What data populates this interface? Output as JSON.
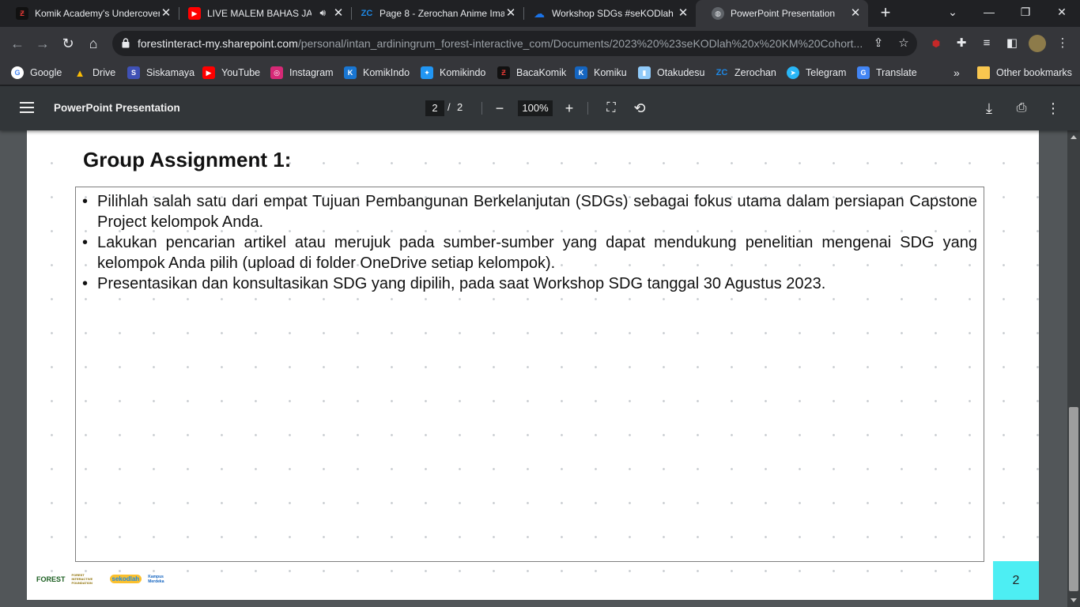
{
  "tabs": [
    {
      "title": "Komik Academy's Undercover",
      "favicon": "komik-icon",
      "color": "#c62828"
    },
    {
      "title": "LIVE MALEM BAHAS JAJA",
      "favicon": "youtube-icon",
      "color": "#ff0000"
    },
    {
      "title": "Page 8 - Zerochan Anime Ima",
      "favicon": "zerochan-icon",
      "color": "#1e88e5"
    },
    {
      "title": "Workshop SDGs #seKODlah",
      "favicon": "onedrive-icon",
      "color": "#1a73e8"
    },
    {
      "title": "PowerPoint Presentation",
      "favicon": "globe-icon",
      "color": "#9aa0a6"
    }
  ],
  "address": {
    "host": "forestinteract-my.sharepoint.com",
    "path": "/personal/intan_ardiningrum_forest-interactive_com/Documents/2023%20%23seKODlah%20x%20KM%20Cohort..."
  },
  "bookmarks": [
    {
      "label": "Google",
      "icon": "google-icon",
      "color": "#4285f4"
    },
    {
      "label": "Drive",
      "icon": "drive-icon",
      "color": "#0f9d58"
    },
    {
      "label": "Siskamaya",
      "icon": "siskamaya-icon",
      "color": "#3f51b5"
    },
    {
      "label": "YouTube",
      "icon": "youtube-icon",
      "color": "#ff0000"
    },
    {
      "label": "Instagram",
      "icon": "instagram-icon",
      "color": "#d62976"
    },
    {
      "label": "KomikIndo",
      "icon": "komikindo-icon",
      "color": "#1976d2"
    },
    {
      "label": "Komikindo",
      "icon": "komikindo-icon",
      "color": "#2196f3"
    },
    {
      "label": "BacaKomik",
      "icon": "bacakomik-icon",
      "color": "#c62828"
    },
    {
      "label": "Komiku",
      "icon": "komiku-icon",
      "color": "#1565c0"
    },
    {
      "label": "Otakudesu",
      "icon": "otakudesu-icon",
      "color": "#90caf9"
    },
    {
      "label": "Zerochan",
      "icon": "zerochan-icon",
      "color": "#1e88e5"
    },
    {
      "label": "Telegram",
      "icon": "telegram-icon",
      "color": "#29b6f6"
    },
    {
      "label": "Translate",
      "icon": "translate-icon",
      "color": "#4285f4"
    }
  ],
  "bookmarks_overflow": "»",
  "other_bookmarks": "Other bookmarks",
  "pdf": {
    "title": "PowerPoint Presentation",
    "current_page": "2",
    "separator": "/",
    "total_pages": "2",
    "zoom": "100%"
  },
  "slide": {
    "title": "Group Assignment 1:",
    "bullets": [
      "Pilihlah salah satu dari empat Tujuan Pembangunan Berkelanjutan (SDGs) sebagai fokus utama dalam persiapan Capstone Project kelompok Anda.",
      "Lakukan pencarian artikel atau merujuk pada sumber-sumber yang dapat mendukung penelitian mengenai SDG yang kelompok Anda pilih (upload di folder OneDrive setiap kelompok).",
      "Presentasikan dan konsultasikan SDG yang dipilih, pada saat Workshop SDG tanggal 30 Agustus 2023."
    ],
    "logos": [
      "FOREST",
      "FOREST INTERACTIVE FOUNDATION",
      "sekodlah",
      "Kampus Merdeka"
    ],
    "page_number": "2",
    "accent": "#4deef3"
  }
}
